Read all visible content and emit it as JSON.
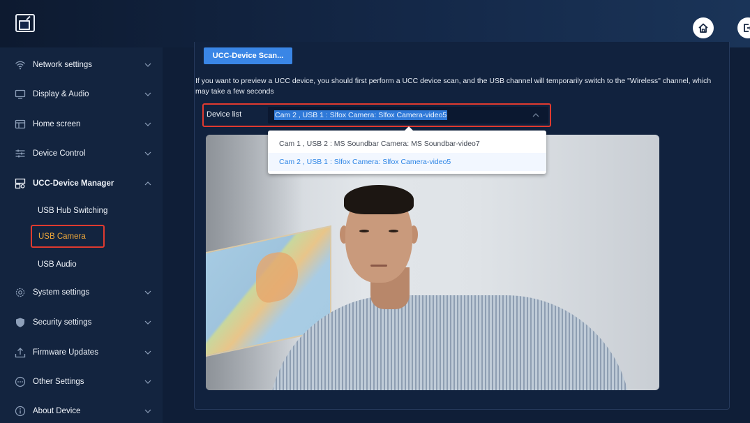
{
  "sidebar": {
    "items": [
      {
        "label": "Network settings",
        "icon": "wifi-icon"
      },
      {
        "label": "Display & Audio",
        "icon": "monitor-icon"
      },
      {
        "label": "Home screen",
        "icon": "home-screen-icon"
      },
      {
        "label": "Device Control",
        "icon": "sliders-icon"
      },
      {
        "label": "UCC-Device Manager",
        "icon": "device-manager-icon"
      },
      {
        "label": "System settings",
        "icon": "gear-icon"
      },
      {
        "label": "Security settings",
        "icon": "shield-icon"
      },
      {
        "label": "Firmware Updates",
        "icon": "upload-icon"
      },
      {
        "label": "Other Settings",
        "icon": "more-icon"
      },
      {
        "label": "About Device",
        "icon": "info-icon"
      }
    ],
    "subitems": [
      {
        "label": "USB Hub Switching"
      },
      {
        "label": "USB Camera"
      },
      {
        "label": "USB Audio"
      }
    ]
  },
  "main": {
    "scan_button": "UCC-Device Scan...",
    "description": "If you want to preview a UCC device, you should first perform a UCC device scan, and the USB channel will temporarily switch to the \"Wireless\" channel, which may take a few seconds",
    "device_list_label": "Device list",
    "device_selected": "Cam 2 , USB 1 : Slfox Camera: Slfox Camera-video5",
    "device_options": [
      "Cam 1 , USB 2 : MS Soundbar Camera: MS Soundbar-video7",
      "Cam 2 , USB 1 : Slfox Camera: Slfox Camera-video5"
    ]
  },
  "colors": {
    "accent": "#3a86e6",
    "highlight_border": "#e03a2f",
    "active_text": "#f0a93a",
    "sidebar_bg": "#13243f"
  }
}
